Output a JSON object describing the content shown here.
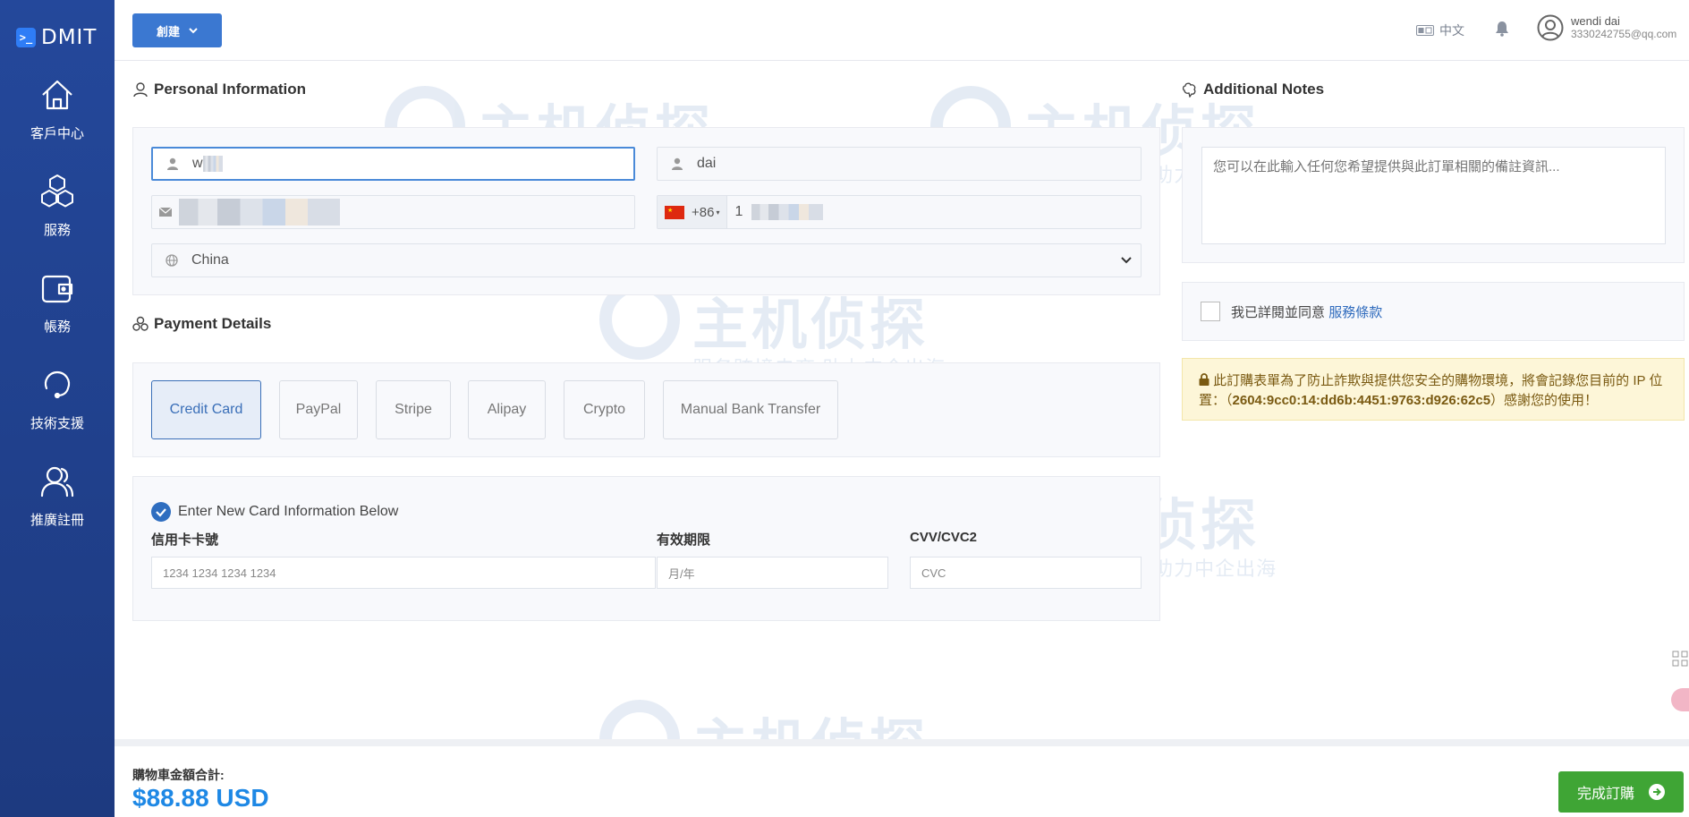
{
  "brand": {
    "name": "DMIT",
    "mark": ">_"
  },
  "sidebar": {
    "items": [
      {
        "label": "客戶中心",
        "icon": "home-icon"
      },
      {
        "label": "服務",
        "icon": "cubes-icon"
      },
      {
        "label": "帳務",
        "icon": "wallet-icon"
      },
      {
        "label": "技術支援",
        "icon": "support-icon"
      },
      {
        "label": "推廣註冊",
        "icon": "users-icon"
      }
    ]
  },
  "topbar": {
    "create_label": "創建",
    "language": "中文",
    "user_name": "wendi dai",
    "user_email": "3330242755@qq.com"
  },
  "watermark": {
    "title": "主机侦探",
    "subtitle": "服务跨境电商 助力中企出海"
  },
  "personal": {
    "title": "Personal Information",
    "first_name_value": "w",
    "last_name_value": "dai",
    "phone_code": "+86",
    "phone_prefix": "1",
    "country": "China",
    "country_options": [
      "China"
    ]
  },
  "payment": {
    "title": "Payment Details",
    "methods": [
      "Credit Card",
      "PayPal",
      "Stripe",
      "Alipay",
      "Crypto",
      "Manual Bank Transfer"
    ],
    "selected": "Credit Card",
    "new_card_label": "Enter New Card Information Below",
    "card_number_label": "信用卡卡號",
    "card_number_placeholder": "1234 1234 1234 1234",
    "expiry_label": "有效期限",
    "expiry_placeholder": "月/年",
    "cvv_label": "CVV/CVC2",
    "cvv_placeholder": "CVC"
  },
  "notes": {
    "title": "Additional Notes",
    "placeholder": "您可以在此輸入任何您希望提供與此訂單相關的備註資訊..."
  },
  "tos": {
    "text": "我已詳閱並同意",
    "link": "服務條款"
  },
  "ip_alert": {
    "text_before": "此訂購表單為了防止詐欺與提供您安全的購物環境，將會記錄您目前的 IP 位置：（",
    "ip": "2604:9cc0:14:dd6b:4451:9763:d926:62c5",
    "text_after": "）感謝您的使用！"
  },
  "cart": {
    "total_label": "購物車金額合計:",
    "total": "$88.88 USD"
  },
  "finish_label": "完成訂購",
  "colors": {
    "sidebar": "#1f3d8c",
    "primary": "#3b78d1",
    "success": "#3fa535",
    "total": "#1e88e5"
  }
}
